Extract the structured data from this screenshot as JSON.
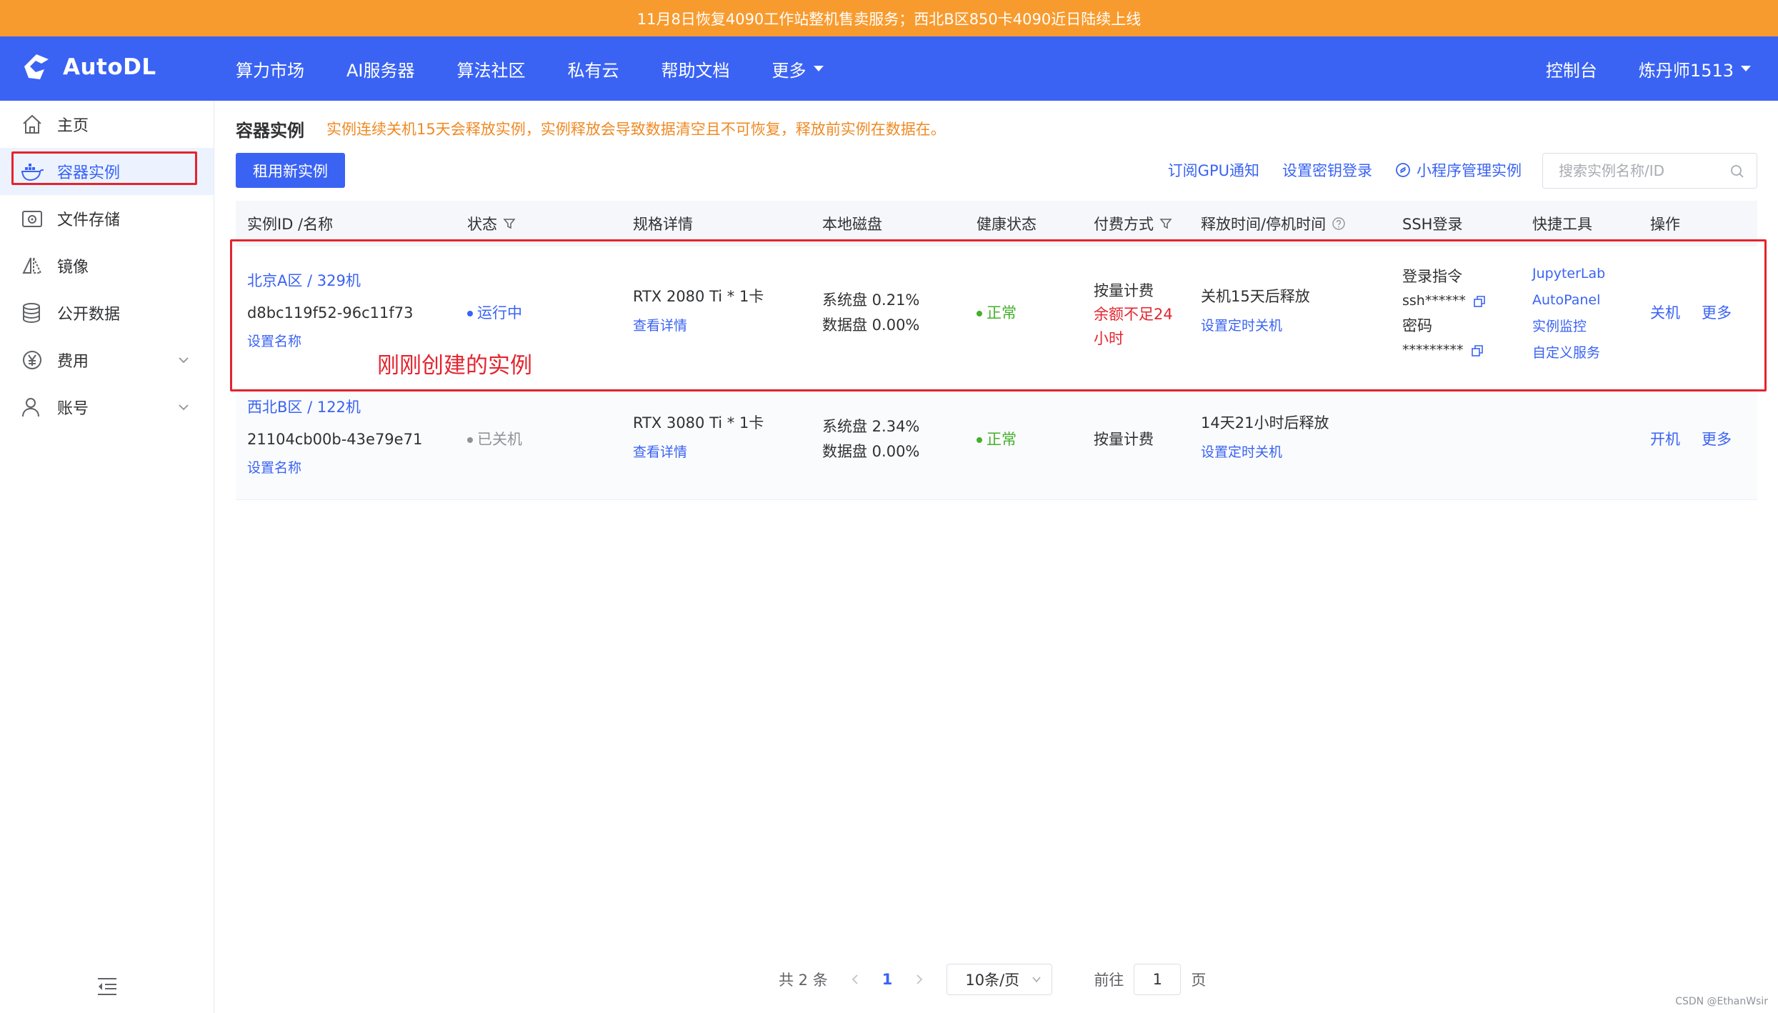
{
  "announcement": "11月8日恢复4090工作站整机售卖服务；西北B区850卡4090近日陆续上线",
  "topnav": {
    "brand": "AutoDL",
    "items": [
      "算力市场",
      "AI服务器",
      "算法社区",
      "私有云",
      "帮助文档",
      "更多"
    ],
    "console": "控制台",
    "user": "炼丹师1513"
  },
  "sidebar": {
    "items": [
      {
        "label": "主页",
        "icon": "home-icon"
      },
      {
        "label": "容器实例",
        "icon": "docker-icon"
      },
      {
        "label": "文件存储",
        "icon": "disk-icon"
      },
      {
        "label": "镜像",
        "icon": "mirror-icon"
      },
      {
        "label": "公开数据",
        "icon": "database-icon"
      },
      {
        "label": "费用",
        "icon": "yen-icon"
      },
      {
        "label": "账号",
        "icon": "user-icon"
      }
    ]
  },
  "page": {
    "title": "容器实例",
    "warning": "实例连续关机15天会释放实例，实例释放会导致数据清空且不可恢复，释放前实例在数据在。",
    "new_button": "租用新实例",
    "links": [
      "订阅GPU通知",
      "设置密钥登录",
      "小程序管理实例"
    ],
    "search_placeholder": "搜索实例名称/ID"
  },
  "table": {
    "headers": [
      "实例ID /名称",
      "状态",
      "规格详情",
      "本地磁盘",
      "健康状态",
      "付费方式",
      "释放时间/停机时间",
      "SSH登录",
      "快捷工具",
      "操作"
    ],
    "rows": [
      {
        "name": "北京A区 / 329机",
        "id": "d8bc119f52-96c11f73",
        "set_name": "设置名称",
        "status": "运行中",
        "spec": "RTX 2080 Ti * 1卡",
        "spec_link": "查看详情",
        "sys_disk": "系统盘 0.21%",
        "data_disk": "数据盘 0.00%",
        "health": "正常",
        "billing": "按量计费",
        "billing_warn_1": "余额不足24",
        "billing_warn_2": "小时",
        "release": "关机15天后释放",
        "release_link": "设置定时关机",
        "ssh_cmd_label": "登录指令",
        "ssh_cmd": "ssh******",
        "ssh_pwd_label": "密码",
        "ssh_pwd": "*********",
        "tools": [
          "JupyterLab",
          "AutoPanel",
          "实例监控",
          "自定义服务"
        ],
        "action_main": "关机",
        "action_more": "更多"
      },
      {
        "name": "西北B区 / 122机",
        "id": "21104cb00b-43e79e71",
        "set_name": "设置名称",
        "status": "已关机",
        "spec": "RTX 3080 Ti * 1卡",
        "spec_link": "查看详情",
        "sys_disk": "系统盘 2.34%",
        "data_disk": "数据盘 0.00%",
        "health": "正常",
        "billing": "按量计费",
        "release": "14天21小时后释放",
        "release_link": "设置定时关机",
        "action_main": "开机",
        "action_more": "更多"
      }
    ]
  },
  "annotation": "刚刚创建的实例",
  "pagination": {
    "total": "共 2 条",
    "current": "1",
    "page_size": "10条/页",
    "goto_label": "前往",
    "goto_value": "1",
    "page_unit": "页"
  },
  "watermark": "CSDN @EthanWsir",
  "colors": {
    "brand": "#3a63f4",
    "announce": "#f89b2e",
    "warning": "#f08a24",
    "ok": "#43b02a",
    "danger": "#e4242f"
  }
}
